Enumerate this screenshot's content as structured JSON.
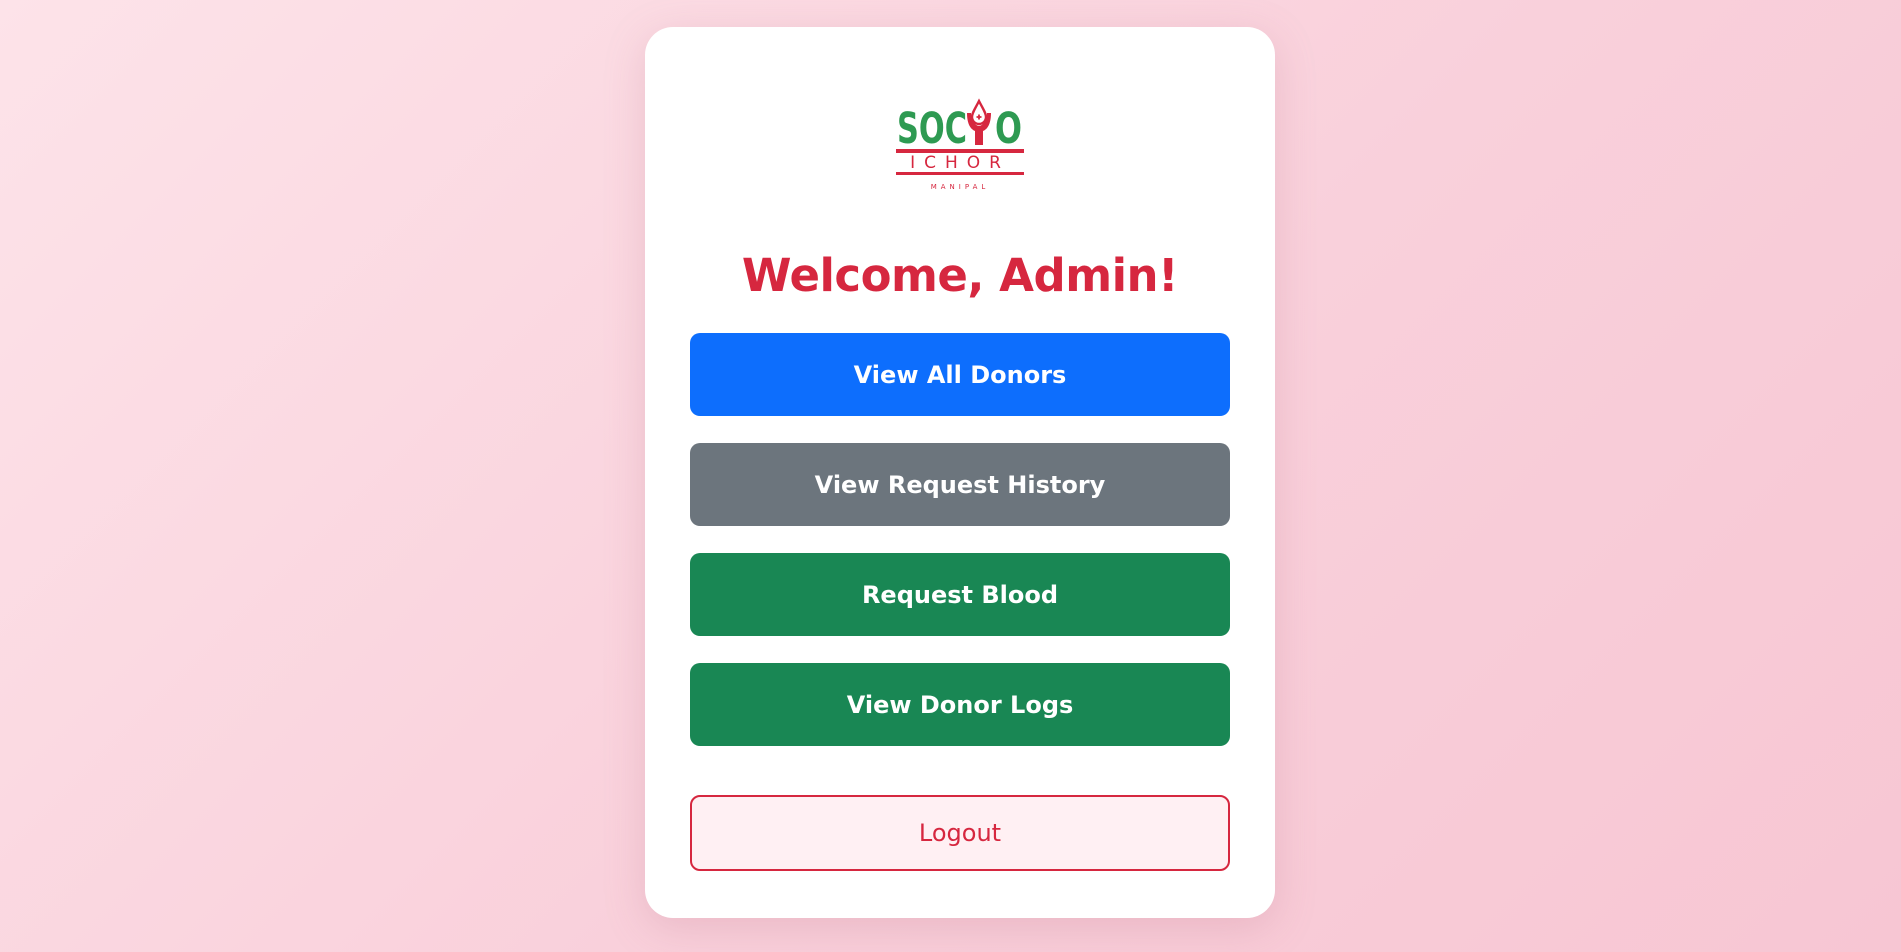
{
  "brand": {
    "logo_top": "SOC O",
    "logo_middle": "ICHOR",
    "logo_bottom": "MANIPAL",
    "green": "#2e9a52",
    "red": "#d6273f"
  },
  "heading": {
    "title": "Welcome, Admin!"
  },
  "actions": [
    {
      "label": "View All Donors",
      "color": "#0d6efd"
    },
    {
      "label": "View Request History",
      "color": "#6c757d"
    },
    {
      "label": "Request Blood",
      "color": "#198754"
    },
    {
      "label": "View Donor Logs",
      "color": "#198754"
    }
  ],
  "logout": {
    "label": "Logout"
  }
}
